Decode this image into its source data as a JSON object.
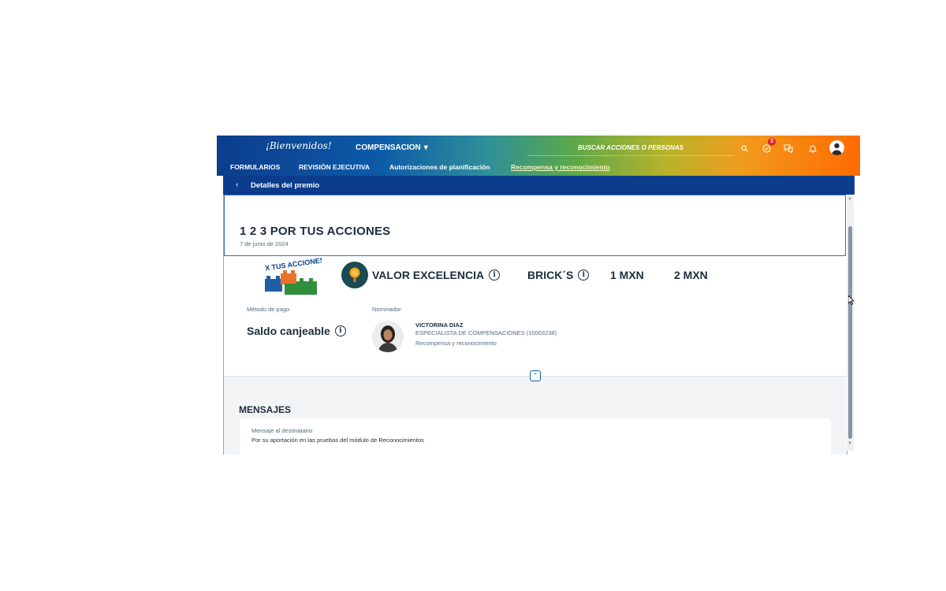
{
  "header": {
    "logo_text": "¡Bienvenidos!",
    "module_label": "COMPENSACION",
    "search_placeholder": "BUSCAR ACCIONES O PERSONAS",
    "notification_badge": "3"
  },
  "nav": {
    "items": [
      "FORMULARIOS",
      "REVISIÓN EJECUTIVA",
      "Autorizaciones de planificación",
      "Recompensa y reconocimiento"
    ],
    "active_index": 3
  },
  "subheader": {
    "title": "Detalles del premio"
  },
  "award": {
    "title": "1 2 3 POR TUS ACCIONES",
    "date": "7 de junio de 2024",
    "image_text": "X TUS ACCIONES",
    "value_label": "VALOR EXCELENCIA",
    "currency_label": "BRICK´S",
    "amount_1": "1 MXN",
    "amount_2": "2 MXN"
  },
  "payment": {
    "label": "Método de pago",
    "value": "Saldo canjeable"
  },
  "nominator": {
    "label": "Nominador",
    "name": "VICTORINA DIAZ",
    "role": "ESPECIALISTA DE COMPENSACIONES (10003238)",
    "department": "Recompensa y reconocimiento"
  },
  "messages": {
    "title": "MENSAJES",
    "label": "Mensaje al destinatario",
    "text": "Por su aportación en las pruebas del módulo de Reconocimientos"
  },
  "colors": {
    "primary_blue": "#0b3d8c",
    "accent_orange": "#ff6a00",
    "text_dark": "#1d2d3e",
    "badge_red": "#e3212f"
  }
}
